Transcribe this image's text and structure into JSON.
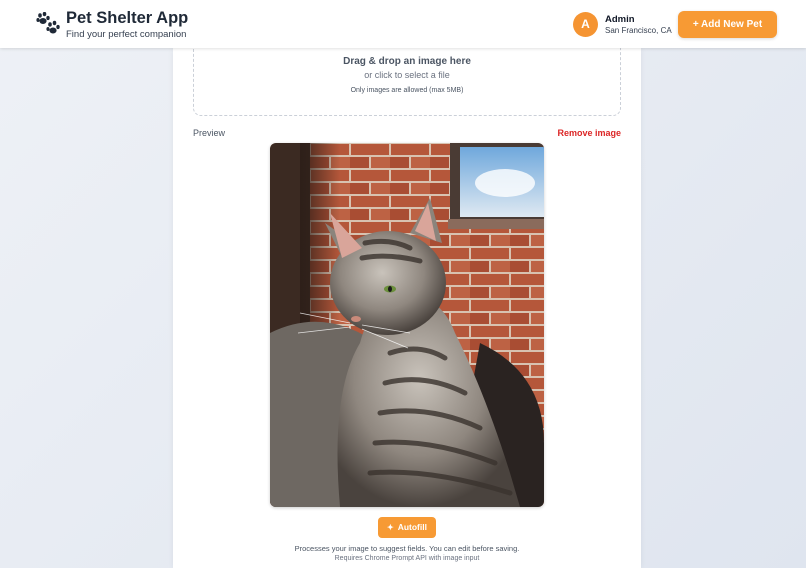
{
  "header": {
    "logo_icon": "paw-icon",
    "title": "Pet Shelter App",
    "subtitle": "Find your perfect companion",
    "user": {
      "avatar_initial": "A",
      "name": "Admin",
      "location": "San Francisco, CA"
    },
    "add_button_label": "+ Add New Pet"
  },
  "upload": {
    "title": "Drag & drop an image here",
    "subtitle": "or click to select a file",
    "note": "Only images are allowed (max 5MB)"
  },
  "preview": {
    "label": "Preview",
    "remove_label": "Remove image"
  },
  "autofill": {
    "icon": "sparkle-icon",
    "label": "Autofill",
    "help_text": "Processes your image to suggest fields. You can edit before saving.",
    "requirement_note": "Requires Chrome Prompt API with image input"
  },
  "colors": {
    "accent": "#f79a34",
    "danger": "#dc2626",
    "avatar": "#f59432"
  }
}
